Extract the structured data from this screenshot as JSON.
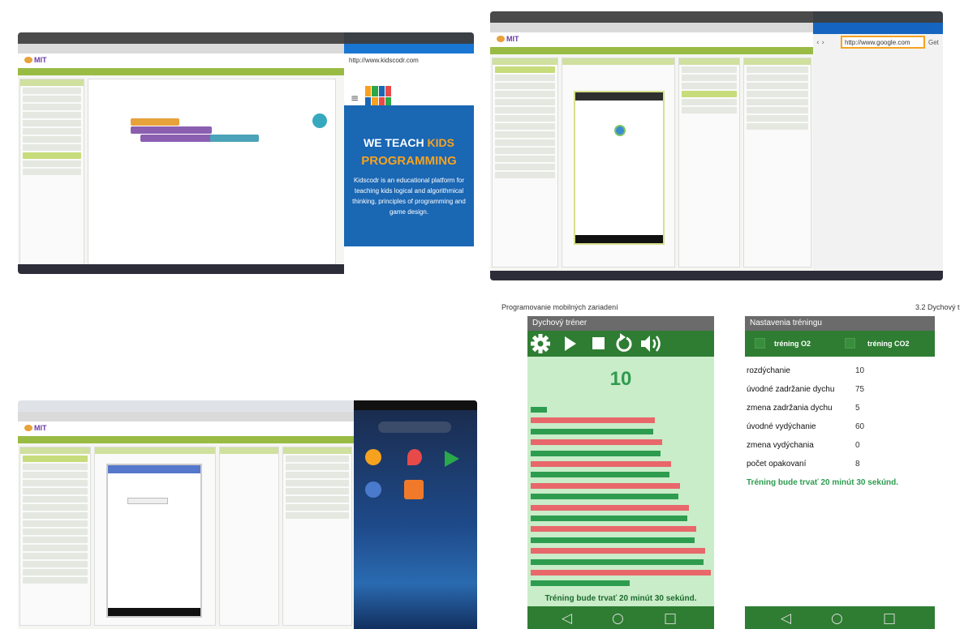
{
  "screenshot_top_left": {
    "browser_url": "http://www.kidscodr.com",
    "headline_line1_a": "WE TEACH ",
    "headline_line1_b": "KIDS",
    "headline_line2": "PROGRAMMING",
    "body_text": "Kidscodr is an educational platform for teaching kids logical and algorithmical thinking, principles of programming and game design.",
    "logo_letters": [
      "K",
      "I",
      "D",
      "S",
      "C",
      "O",
      "D",
      "R"
    ]
  },
  "screenshot_top_right": {
    "browser_url": "http://www.google.com"
  },
  "page_header": {
    "left": "Programovanie mobilných zariadení",
    "right": "3.2 Dychový t"
  },
  "trainer_screen": {
    "title": "Dychový tréner",
    "toolbar_icons": [
      "gear-icon",
      "play-icon",
      "stop-icon",
      "replay-icon",
      "volume-icon"
    ],
    "counter": "10",
    "status": "Tréning bude trvať 20 minút 30 sekúnd.",
    "bars_percent": [
      {
        "color": "green",
        "value": 9
      },
      {
        "color": "red",
        "value": 69
      },
      {
        "color": "green",
        "value": 68
      },
      {
        "color": "red",
        "value": 73
      },
      {
        "color": "green",
        "value": 72
      },
      {
        "color": "red",
        "value": 78
      },
      {
        "color": "green",
        "value": 77
      },
      {
        "color": "red",
        "value": 83
      },
      {
        "color": "green",
        "value": 82
      },
      {
        "color": "red",
        "value": 88
      },
      {
        "color": "green",
        "value": 87
      },
      {
        "color": "red",
        "value": 92
      },
      {
        "color": "green",
        "value": 91
      },
      {
        "color": "red",
        "value": 97
      },
      {
        "color": "green",
        "value": 96
      },
      {
        "color": "red",
        "value": 100
      },
      {
        "color": "green",
        "value": 55
      }
    ],
    "nav_icons": [
      "◁",
      "○",
      "□"
    ]
  },
  "settings_screen": {
    "title": "Nastavenia tréningu",
    "tabs": [
      {
        "label": "tréning O2"
      },
      {
        "label": "tréning CO2"
      }
    ],
    "rows": [
      {
        "label": "rozdýchanie",
        "value": "10"
      },
      {
        "label": "úvodné zadržanie dychu",
        "value": "75"
      },
      {
        "label": "zmena zadržania dychu",
        "value": "5"
      },
      {
        "label": "úvodné vydýchanie",
        "value": "60"
      },
      {
        "label": "zmena vydýchania",
        "value": "0"
      },
      {
        "label": "počet opakovaní",
        "value": "8"
      }
    ],
    "summary": "Tréning bude trvať 20 minút 30 sekúnd.",
    "nav_icons": [
      "◁",
      "○",
      "□"
    ]
  },
  "colors": {
    "ai_green": "#99bb44",
    "app_green": "#2e7d32",
    "bar_red": "#e8676a",
    "bar_green": "#2e9c4f",
    "panel_bg": "#c9ecc9",
    "kids_blue": "#1a67b4",
    "kids_accent": "#f6a21f"
  }
}
